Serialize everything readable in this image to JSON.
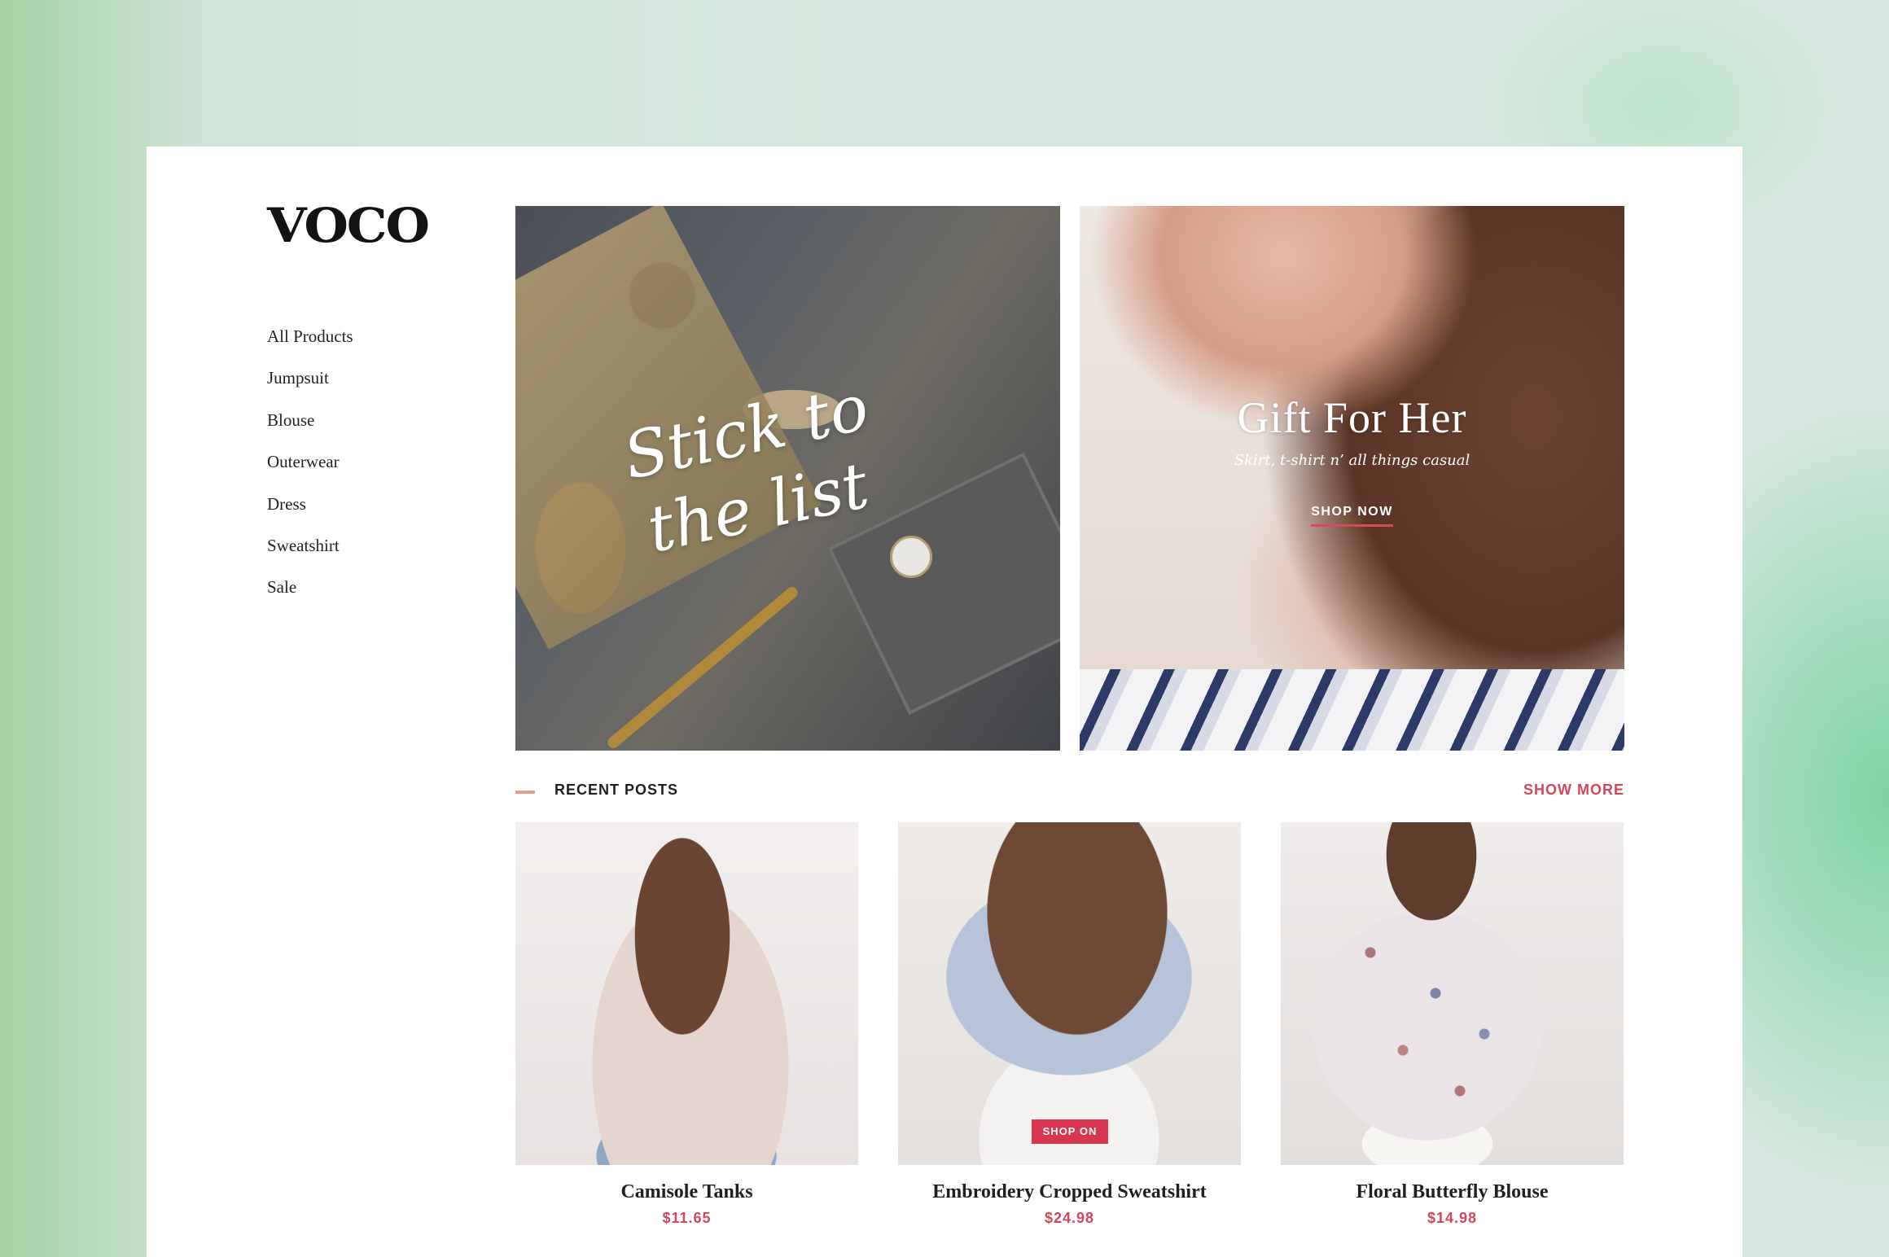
{
  "brand": {
    "logo": "VOCO"
  },
  "nav": {
    "items": [
      "All Products",
      "Jumpsuit",
      "Blouse",
      "Outerwear",
      "Dress",
      "Sweatshirt",
      "Sale"
    ]
  },
  "banners": {
    "left": {
      "script_line1": "Stick to",
      "script_line2": "the list"
    },
    "right": {
      "title": "Gift For Her",
      "subtitle": "Skirt, t-shirt n’ all things casual",
      "cta": "SHOP NOW"
    }
  },
  "recent": {
    "title": "RECENT POSTS",
    "show_more": "SHOW MORE",
    "products": [
      {
        "name": "Camisole Tanks",
        "price": "$11.65"
      },
      {
        "name": "Embroidery Cropped Sweatshirt",
        "price": "$24.98",
        "badge": "SHOP ON"
      },
      {
        "name": "Floral Butterfly Blouse",
        "price": "$14.98"
      }
    ]
  },
  "colors": {
    "accent": "#d2475a",
    "dash": "#e99d86",
    "badge": "#d8364d"
  }
}
